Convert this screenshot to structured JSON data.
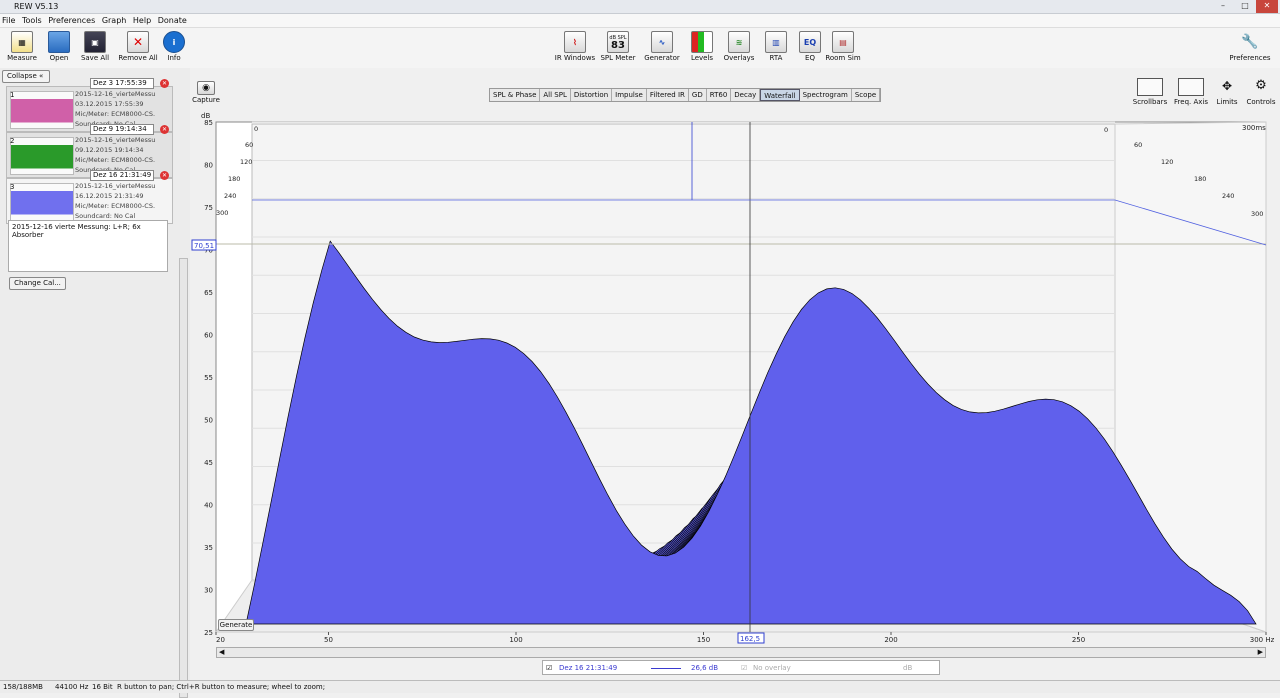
{
  "window": {
    "title": "REW V5.13"
  },
  "menu": [
    "File",
    "Tools",
    "Preferences",
    "Graph",
    "Help",
    "Donate"
  ],
  "toolbar_left": [
    {
      "label": "Measure",
      "icon": "measure-icon"
    },
    {
      "label": "Open",
      "icon": "folder-icon"
    },
    {
      "label": "Save All",
      "icon": "save-icon"
    },
    {
      "label": "Remove All",
      "icon": "remove-icon"
    },
    {
      "label": "Info",
      "icon": "info-icon"
    }
  ],
  "toolbar_center": [
    {
      "label": "IR Windows",
      "icon": "ir-windows-icon"
    },
    {
      "label": "SPL Meter",
      "icon": "spl-meter-icon",
      "badge": "83",
      "badge_top": "dB SPL"
    },
    {
      "label": "Generator",
      "icon": "generator-icon"
    },
    {
      "label": "Levels",
      "icon": "levels-icon"
    },
    {
      "label": "Overlays",
      "icon": "overlays-icon"
    },
    {
      "label": "RTA",
      "icon": "rta-icon"
    },
    {
      "label": "EQ",
      "icon": "eq-icon"
    },
    {
      "label": "Room Sim",
      "icon": "room-sim-icon"
    }
  ],
  "preferences_label": "Preferences",
  "capture_label": "Capture",
  "panel": {
    "collapse_label": "Collapse",
    "measurements": [
      {
        "num": "1",
        "time": "Dez 3 17:55:39",
        "name": "2015-12-16_vierteMessu",
        "date": "03.12.2015 17:55:39",
        "mic": "Mic/Meter: ECM8000-CS.",
        "soundcard": "Soundcard: No Cal",
        "color": "#c0308c"
      },
      {
        "num": "2",
        "time": "Dez 9 19:14:34",
        "name": "2015-12-16_vierteMessu",
        "date": "09.12.2015 19:14:34",
        "mic": "Mic/Meter: ECM8000-CS.",
        "soundcard": "Soundcard: No Cal",
        "color": "#1f8a1f"
      },
      {
        "num": "3",
        "time": "Dez 16 21:31:49",
        "name": "2015-12-16_vierteMessu",
        "date": "16.12.2015 21:31:49",
        "mic": "Mic/Meter: ECM8000-CS.",
        "soundcard": "Soundcard: No Cal",
        "color": "#5a5aee"
      }
    ],
    "notes": "2015-12-16 vierte Messung: L+R; 6x Absorber",
    "change_cal_label": "Change Cal..."
  },
  "graph_tabs": [
    "SPL & Phase",
    "All SPL",
    "Distortion",
    "Impulse",
    "Filtered IR",
    "GD",
    "RT60",
    "Decay",
    "Waterfall",
    "Spectrogram",
    "Scope"
  ],
  "active_tab": "Waterfall",
  "right_tools": [
    "Scrollbars",
    "Freq. Axis",
    "Limits",
    "Controls"
  ],
  "chart_data": {
    "type": "area",
    "chart_kind": "waterfall",
    "ylabel": "dB",
    "y_ticks": [
      "85",
      "80",
      "75",
      "70",
      "65",
      "60",
      "55",
      "50",
      "45",
      "40",
      "35",
      "30",
      "25"
    ],
    "ylim": [
      25,
      85
    ],
    "x_ticks": [
      "20",
      "50",
      "100",
      "150",
      "200",
      "250",
      "300 Hz"
    ],
    "xlim": [
      20,
      300
    ],
    "time_ticks_left": [
      "0",
      "60",
      "120",
      "180",
      "240",
      "300"
    ],
    "time_ticks_right": [
      "0",
      "60",
      "120",
      "180",
      "240",
      "300"
    ],
    "time_max_label": "300ms",
    "cursor_y_label": "70,51",
    "cursor_x_label": "162,5",
    "fill_color": "#6060ec",
    "line_color": "#000000",
    "grid": true
  },
  "generate_label": "Generate",
  "legend": {
    "entry": "Dez 16 21:31:49",
    "value": "26,6 dB",
    "overlay": "No overlay",
    "unit": "dB"
  },
  "status": {
    "memory": "158/188MB",
    "rate": "44100 Hz",
    "bits": "16 Bit",
    "hint": "R button to pan; Ctrl+R button to measure; wheel to zoom;"
  }
}
